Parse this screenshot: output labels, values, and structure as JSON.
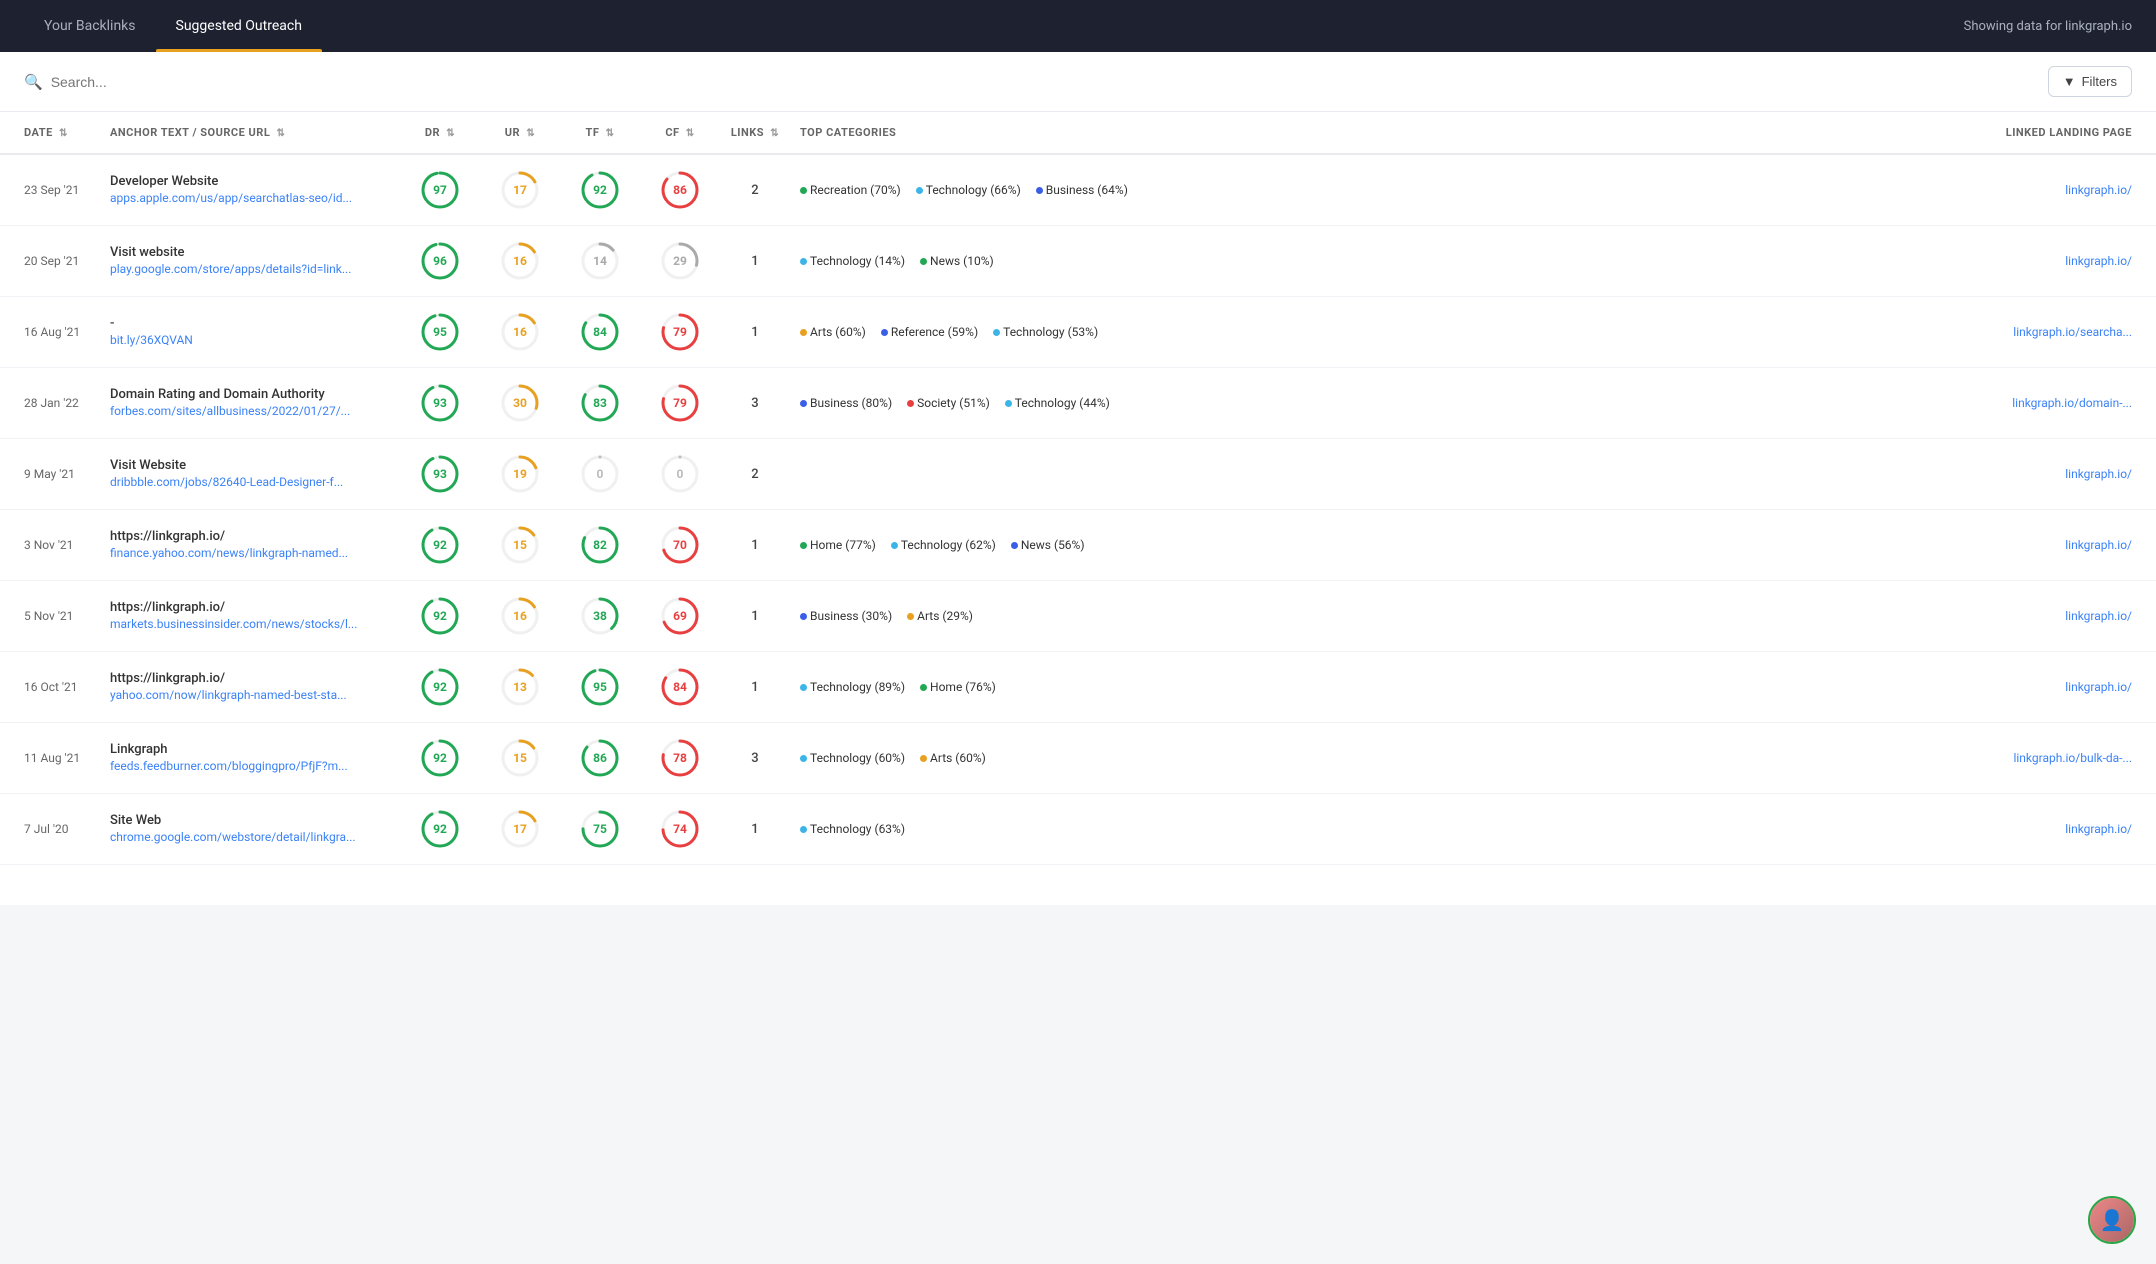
{
  "nav": {
    "tabs": [
      {
        "id": "your-backlinks",
        "label": "Your Backlinks",
        "active": false
      },
      {
        "id": "suggested-outreach",
        "label": "Suggested Outreach",
        "active": true
      }
    ],
    "info": "Showing data for linkgraph.io"
  },
  "toolbar": {
    "search_placeholder": "Search...",
    "filter_label": "Filters"
  },
  "table": {
    "columns": [
      {
        "id": "date",
        "label": "DATE",
        "sortable": true
      },
      {
        "id": "anchor",
        "label": "ANCHOR TEXT / SOURCE URL",
        "sortable": true
      },
      {
        "id": "dr",
        "label": "DR",
        "sortable": true,
        "type": "num"
      },
      {
        "id": "ur",
        "label": "UR",
        "sortable": true,
        "type": "num"
      },
      {
        "id": "tf",
        "label": "TF",
        "sortable": true,
        "type": "num"
      },
      {
        "id": "cf",
        "label": "CF",
        "sortable": true,
        "type": "num"
      },
      {
        "id": "links",
        "label": "LINKS",
        "sortable": true,
        "type": "links"
      },
      {
        "id": "categories",
        "label": "TOP CATEGORIES"
      },
      {
        "id": "landing",
        "label": "LINKED LANDING PAGE"
      }
    ],
    "rows": [
      {
        "date": "23 Sep '21",
        "anchor_text": "Developer Website",
        "source_url": "apps.apple.com/us/app/searchatlas-seo/id...",
        "dr": 97,
        "dr_color": "#22a855",
        "ur": 17,
        "ur_color": "#e8a020",
        "tf": 92,
        "tf_color": "#22a855",
        "cf": 86,
        "cf_color": "#e84040",
        "links": 2,
        "categories": [
          {
            "label": "Recreation (70%)",
            "color": "#22a855"
          },
          {
            "label": "Technology (66%)",
            "color": "#3bb5e8"
          },
          {
            "label": "Business (64%)",
            "color": "#3b5ee8"
          }
        ],
        "landing": "linkgraph.io/"
      },
      {
        "date": "20 Sep '21",
        "anchor_text": "Visit website",
        "source_url": "play.google.com/store/apps/details?id=link...",
        "dr": 96,
        "dr_color": "#22a855",
        "ur": 16,
        "ur_color": "#e8a020",
        "tf": 14,
        "tf_color": "#aaa",
        "cf": 29,
        "cf_color": "#aaa",
        "links": 1,
        "categories": [
          {
            "label": "Technology (14%)",
            "color": "#3bb5e8"
          },
          {
            "label": "News (10%)",
            "color": "#22a855"
          }
        ],
        "landing": "linkgraph.io/"
      },
      {
        "date": "16 Aug '21",
        "anchor_text": "-",
        "source_url": "bit.ly/36XQVAN",
        "dr": 95,
        "dr_color": "#22a855",
        "ur": 16,
        "ur_color": "#e8a020",
        "tf": 84,
        "tf_color": "#22a855",
        "cf": 79,
        "cf_color": "#e84040",
        "links": 1,
        "categories": [
          {
            "label": "Arts (60%)",
            "color": "#e8a020"
          },
          {
            "label": "Reference (59%)",
            "color": "#3b5ee8"
          },
          {
            "label": "Technology (53%)",
            "color": "#3bb5e8"
          }
        ],
        "landing": "linkgraph.io/searcha..."
      },
      {
        "date": "28 Jan '22",
        "anchor_text": "Domain Rating and Domain Authority",
        "source_url": "forbes.com/sites/allbusiness/2022/01/27/...",
        "dr": 93,
        "dr_color": "#22a855",
        "ur": 30,
        "ur_color": "#e8a020",
        "tf": 83,
        "tf_color": "#22a855",
        "cf": 79,
        "cf_color": "#e84040",
        "links": 3,
        "categories": [
          {
            "label": "Business (80%)",
            "color": "#3b5ee8"
          },
          {
            "label": "Society (51%)",
            "color": "#e84040"
          },
          {
            "label": "Technology (44%)",
            "color": "#3bb5e8"
          }
        ],
        "landing": "linkgraph.io/domain-..."
      },
      {
        "date": "9 May '21",
        "anchor_text": "Visit Website",
        "source_url": "dribbble.com/jobs/82640-Lead-Designer-f...",
        "dr": 93,
        "dr_color": "#22a855",
        "ur": 19,
        "ur_color": "#e8a020",
        "tf": 0,
        "tf_color": "#aaa",
        "cf": 0,
        "cf_color": "#aaa",
        "links": 2,
        "categories": [],
        "landing": "linkgraph.io/"
      },
      {
        "date": "3 Nov '21",
        "anchor_text": "https://linkgraph.io/",
        "source_url": "finance.yahoo.com/news/linkgraph-named...",
        "dr": 92,
        "dr_color": "#22a855",
        "ur": 15,
        "ur_color": "#e8a020",
        "tf": 82,
        "tf_color": "#22a855",
        "cf": 70,
        "cf_color": "#e84040",
        "links": 1,
        "categories": [
          {
            "label": "Home (77%)",
            "color": "#22a855"
          },
          {
            "label": "Technology (62%)",
            "color": "#3bb5e8"
          },
          {
            "label": "News (56%)",
            "color": "#3b5ee8"
          }
        ],
        "landing": "linkgraph.io/"
      },
      {
        "date": "5 Nov '21",
        "anchor_text": "https://linkgraph.io/",
        "source_url": "markets.businessinsider.com/news/stocks/l...",
        "dr": 92,
        "dr_color": "#22a855",
        "ur": 16,
        "ur_color": "#e8a020",
        "tf": 38,
        "tf_color": "#22a855",
        "cf": 69,
        "cf_color": "#e84040",
        "links": 1,
        "categories": [
          {
            "label": "Business (30%)",
            "color": "#3b5ee8"
          },
          {
            "label": "Arts (29%)",
            "color": "#e8a020"
          }
        ],
        "landing": "linkgraph.io/"
      },
      {
        "date": "16 Oct '21",
        "anchor_text": "https://linkgraph.io/",
        "source_url": "yahoo.com/now/linkgraph-named-best-sta...",
        "dr": 92,
        "dr_color": "#22a855",
        "ur": 13,
        "ur_color": "#e8a020",
        "tf": 95,
        "tf_color": "#22a855",
        "cf": 84,
        "cf_color": "#e84040",
        "links": 1,
        "categories": [
          {
            "label": "Technology (89%)",
            "color": "#3bb5e8"
          },
          {
            "label": "Home (76%)",
            "color": "#22a855"
          }
        ],
        "landing": "linkgraph.io/"
      },
      {
        "date": "11 Aug '21",
        "anchor_text": "Linkgraph",
        "source_url": "feeds.feedburner.com/bloggingpro/PfjF?m...",
        "dr": 92,
        "dr_color": "#22a855",
        "ur": 15,
        "ur_color": "#e8a020",
        "tf": 86,
        "tf_color": "#22a855",
        "cf": 78,
        "cf_color": "#e84040",
        "links": 3,
        "categories": [
          {
            "label": "Technology (60%)",
            "color": "#3bb5e8"
          },
          {
            "label": "Arts (60%)",
            "color": "#e8a020"
          }
        ],
        "landing": "linkgraph.io/bulk-da-..."
      },
      {
        "date": "7 Jul '20",
        "anchor_text": "Site Web",
        "source_url": "chrome.google.com/webstore/detail/linkgra...",
        "dr": 92,
        "dr_color": "#22a855",
        "ur": 17,
        "ur_color": "#e8a020",
        "tf": 75,
        "tf_color": "#22a855",
        "cf": 74,
        "cf_color": "#e84040",
        "links": 1,
        "categories": [
          {
            "label": "Technology (63%)",
            "color": "#3bb5e8"
          }
        ],
        "landing": "linkgraph.io/"
      }
    ]
  }
}
